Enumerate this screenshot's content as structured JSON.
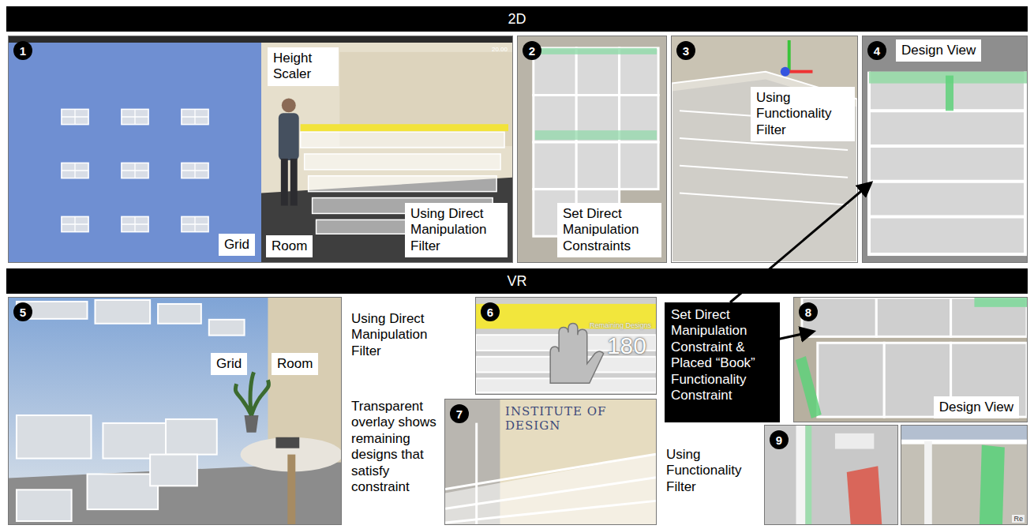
{
  "section_bars": [
    "2D",
    "VR"
  ],
  "panel1": {
    "number": "1",
    "grid_label": "Grid",
    "room_label": "Room",
    "height_label": "Height Scaler",
    "filter_label": "Using Direct Manipulation Filter",
    "readout": "20.00"
  },
  "panel2": {
    "number": "2",
    "label": "Set Direct Manipulation Constraints"
  },
  "panel3": {
    "number": "3",
    "label": "Using Functionality Filter"
  },
  "panel4": {
    "number": "4",
    "label": "Design View"
  },
  "panel5": {
    "number": "5",
    "labels": [
      "Grid",
      "Room"
    ]
  },
  "side_labels": {
    "direct": "Using Direct Manipulation Filter",
    "transparent": "Transparent overlay shows remaining designs that satisfy constraint",
    "functionality": "Using Functionality Filter"
  },
  "panel6": {
    "number": "6",
    "count": "180",
    "overlay": "Remaining Designs"
  },
  "panel7": {
    "number": "7",
    "sign": "INSTITUTE OF DESIGN"
  },
  "callout": "Set Direct Manipulation Constraint & Placed “Book” Functionality Constraint",
  "panel8": {
    "number": "8",
    "label": "Design View"
  },
  "panel9": {
    "number": "9",
    "corner": "Re"
  }
}
